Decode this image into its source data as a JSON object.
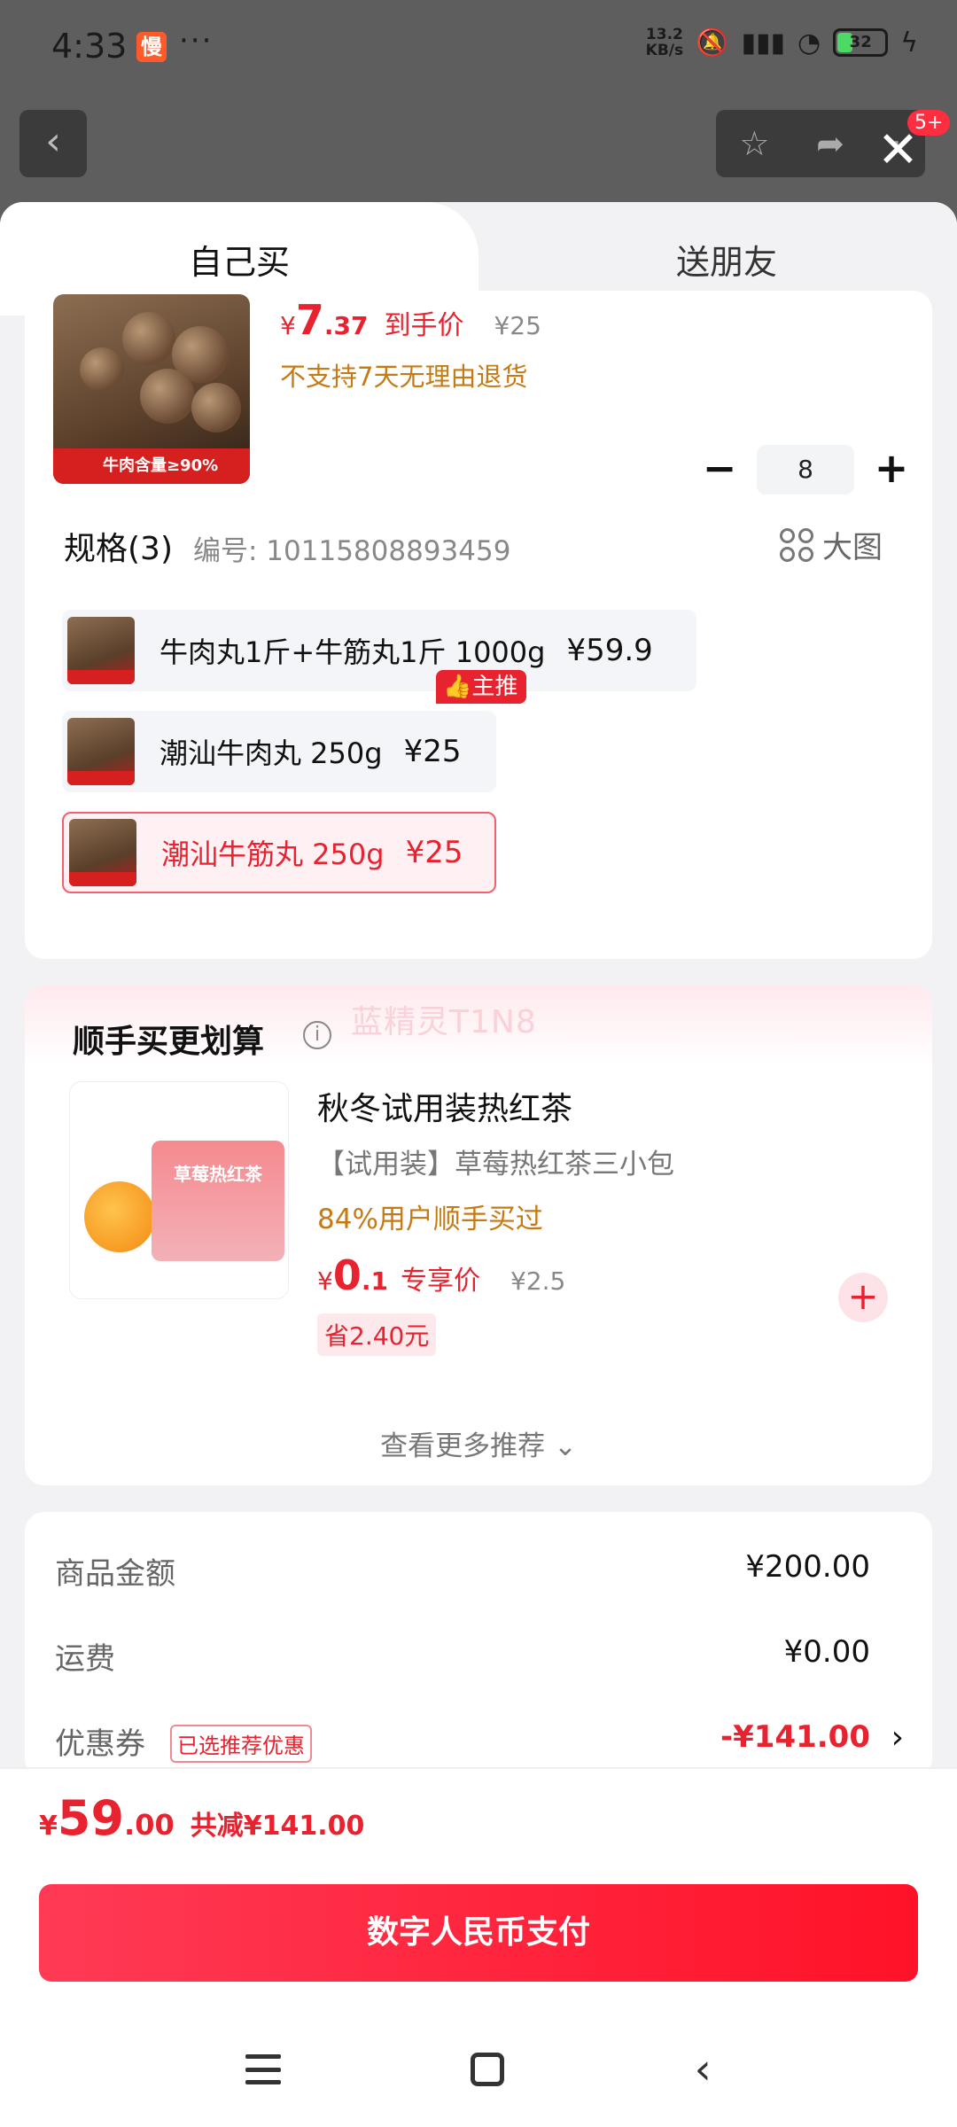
{
  "status_bar": {
    "time": "4:33",
    "app_icon_text": "慢",
    "more_dots": "···",
    "net_speed_value": "13.2",
    "net_speed_unit": "KB/s",
    "battery": "32",
    "icons": [
      "mute-icon",
      "signal-5g-icon",
      "wifi-icon",
      "battery-icon",
      "charging-icon"
    ]
  },
  "top_nav": {
    "badge": "5+"
  },
  "tabs": {
    "self": "自己买",
    "friend": "送朋友"
  },
  "product": {
    "price_yen": "¥",
    "price_int": "7",
    "price_dec": ".37",
    "price_label": "到手价",
    "original_price": "¥25",
    "notice": "不支持7天无理由退货",
    "thumb_banner": "牛肉含量≥90%",
    "quantity": "8"
  },
  "spec": {
    "title": "规格(3)",
    "code": "编号: 10115808893459",
    "big_image": "大图",
    "recommend_badge": "主推",
    "variants": [
      {
        "name": "牛肉丸1斤+牛筋丸1斤 1000g",
        "price": "¥59.9"
      },
      {
        "name": "潮汕牛肉丸 250g",
        "price": "¥25"
      },
      {
        "name": "潮汕牛筋丸 250g",
        "price": "¥25"
      }
    ]
  },
  "addon": {
    "watermark": "蓝精灵T1N8",
    "title": "顺手买更划算",
    "info": "i",
    "bag_text": "草莓热红茶",
    "name": "秋冬试用装热红茶",
    "desc": "【试用装】草莓热红茶三小包",
    "buy_rate": "84%用户顺手买过",
    "price_yen": "¥",
    "price_int": "0",
    "price_dec": ".1",
    "price_label": "专享价",
    "original_price": "¥2.5",
    "save": "省2.40元",
    "add": "+",
    "more": "查看更多推荐"
  },
  "summary": {
    "goods_label": "商品金额",
    "goods_value": "¥200.00",
    "shipping_label": "运费",
    "shipping_value": "¥0.00",
    "coupon_label": "优惠券",
    "coupon_tag": "已选推荐优惠",
    "coupon_value": "-¥141.00"
  },
  "footer": {
    "total_yen": "¥",
    "total_int": "59",
    "total_dec": ".00",
    "reduction": "共减¥141.00",
    "pay_button": "数字人民币支付"
  },
  "colors": {
    "accent": "#e8222f",
    "warning_text": "#c67a13",
    "pay_gradient_start": "#ff3a55",
    "pay_gradient_end": "#ff1228"
  }
}
